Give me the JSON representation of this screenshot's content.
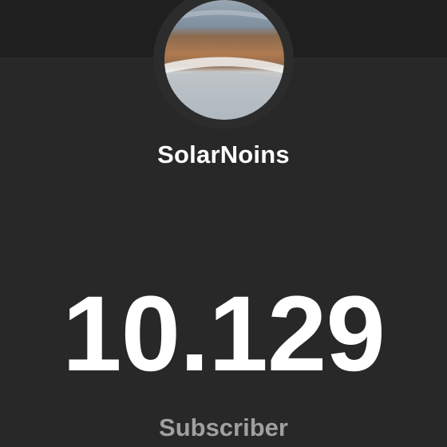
{
  "channel": {
    "name": "SolarNoins",
    "avatar": "channel-avatar-image"
  },
  "stats": {
    "subscriber_count": "10.129",
    "subscriber_label": "Subscriber"
  },
  "colors": {
    "background": "#282828",
    "banner": "#1f1f1f",
    "count_text": "#ffffff",
    "label_text": "#a0a0a0"
  }
}
